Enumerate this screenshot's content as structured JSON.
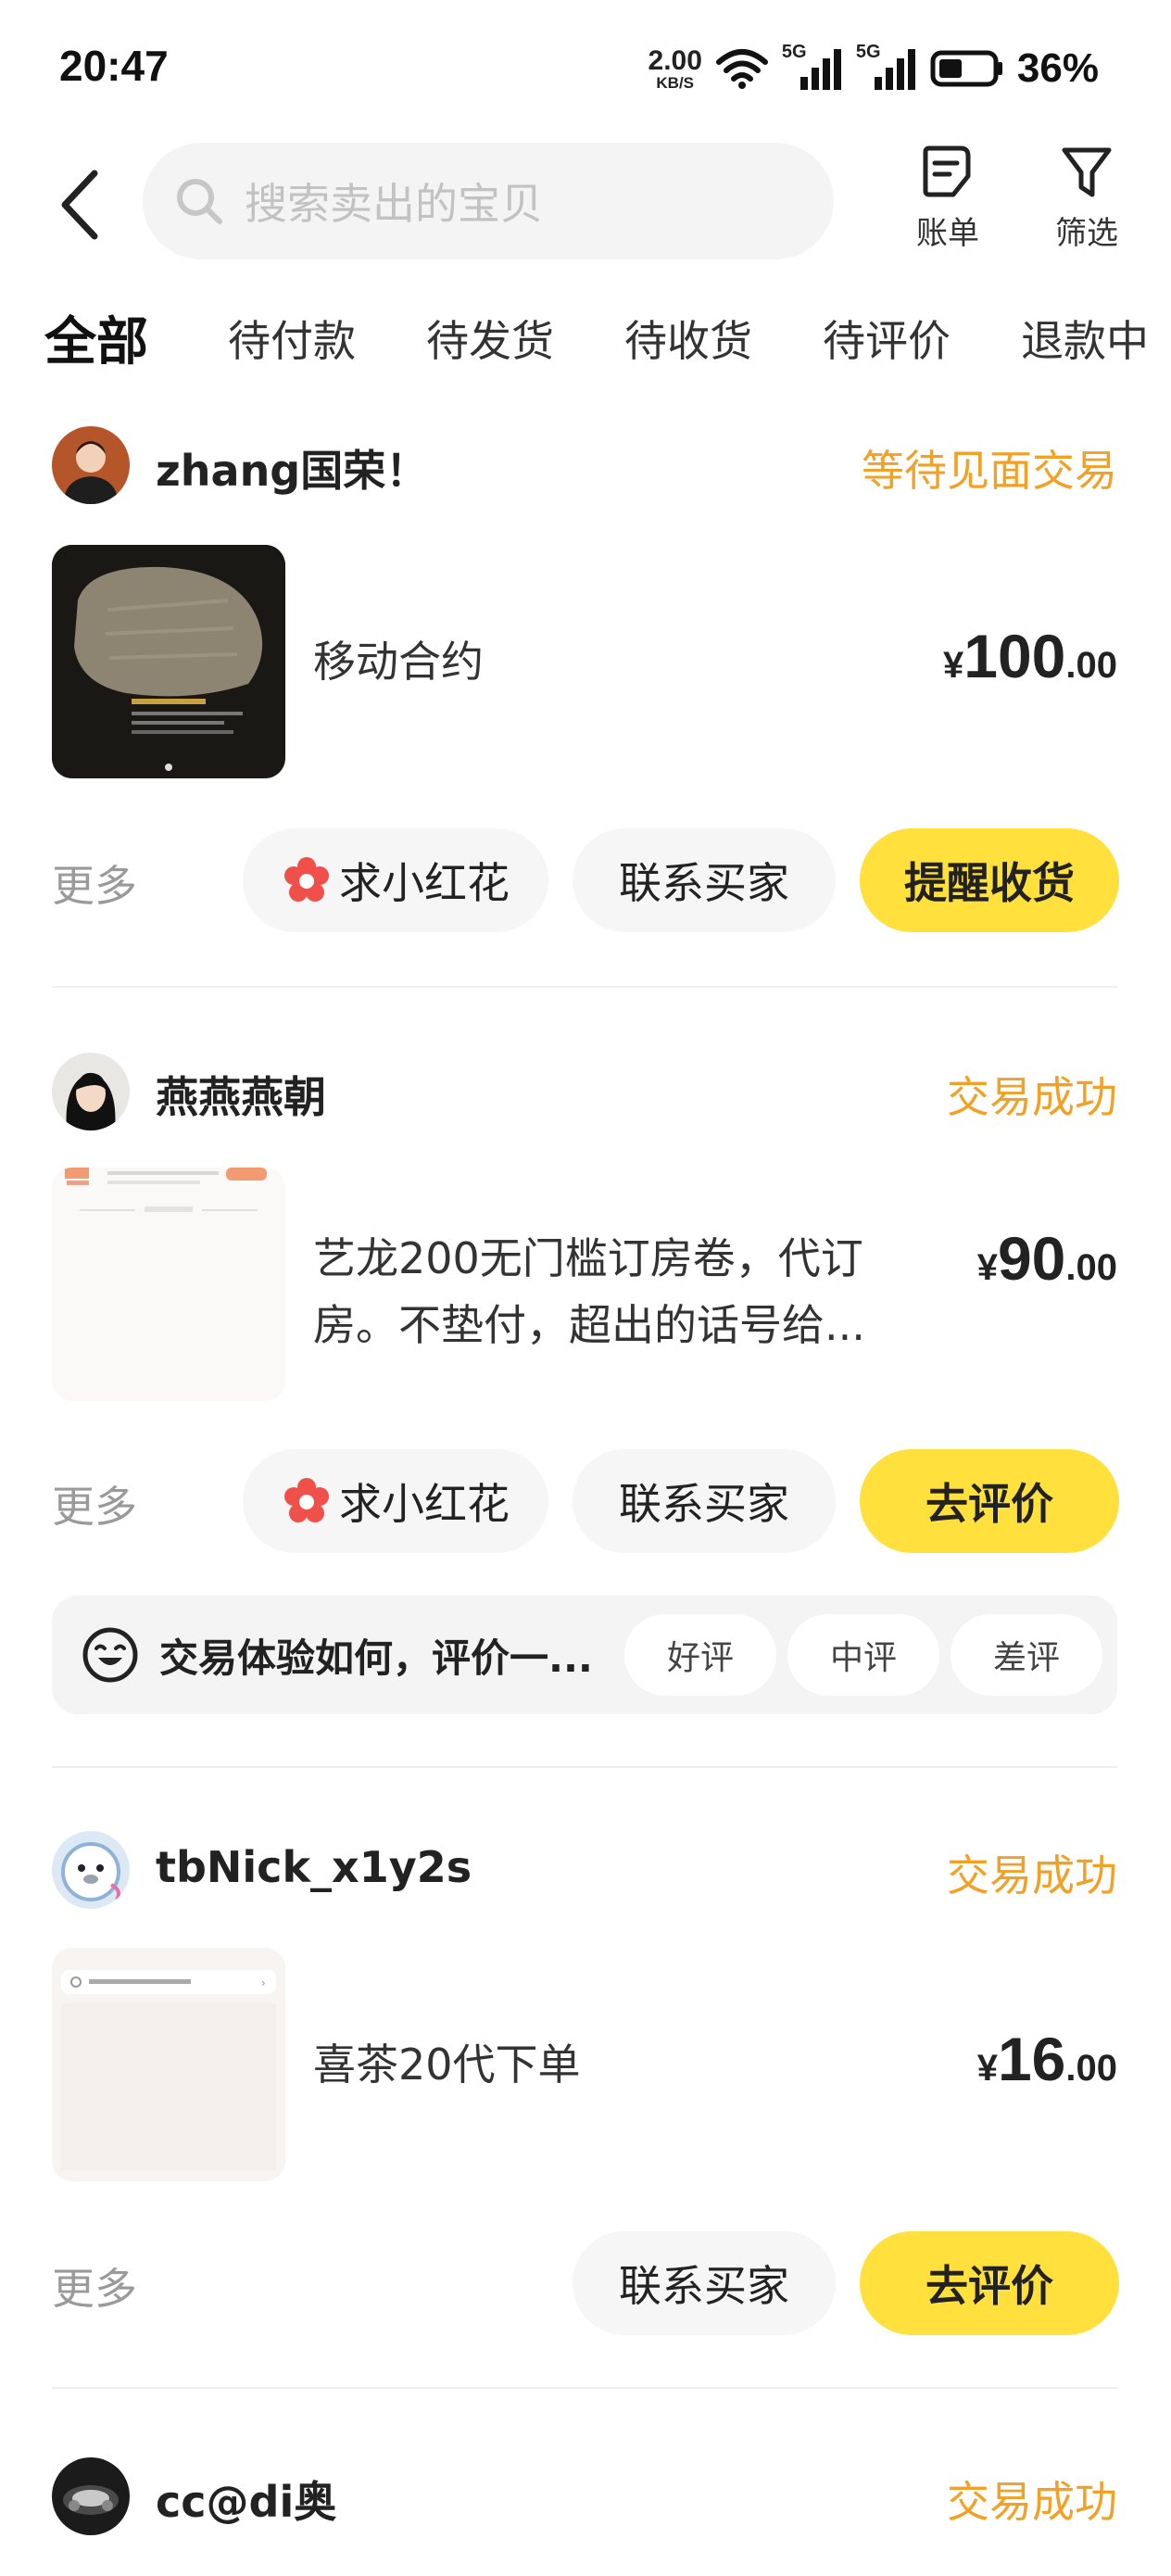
{
  "status_bar": {
    "time": "20:47",
    "net_speed_value": "2.00",
    "net_speed_unit": "KB/S",
    "signal_1": "5G",
    "signal_2": "5G",
    "battery_percent": "36%",
    "icons": [
      "wifi-icon",
      "signal-icon",
      "signal-icon",
      "battery-icon"
    ]
  },
  "header": {
    "search_placeholder": "搜索卖出的宝贝",
    "bill_label": "账单",
    "filter_label": "筛选",
    "icons": [
      "back-arrow-icon",
      "search-icon",
      "bill-icon",
      "filter-icon"
    ]
  },
  "tabs": [
    {
      "label": "全部",
      "active": true
    },
    {
      "label": "待付款"
    },
    {
      "label": "待发货"
    },
    {
      "label": "待收货"
    },
    {
      "label": "待评价"
    },
    {
      "label": "退款中"
    }
  ],
  "orders": [
    {
      "user": "zhang国荣！",
      "status": "等待见面交易",
      "title": "移动合约",
      "price_currency": "¥",
      "price_int": "100",
      "price_dec": ".00",
      "more": "更多",
      "actions": [
        "求小红花",
        "联系买家",
        "提醒收货"
      ]
    },
    {
      "user": "燕燕燕朝",
      "status": "交易成功",
      "title": "艺龙200无门槛订房卷，代订房。不垫付，超出的话号给...",
      "price_currency": "¥",
      "price_int": "90",
      "price_dec": ".00",
      "more": "更多",
      "actions": [
        "求小红花",
        "联系买家",
        "去评价"
      ],
      "review_prompt": "交易体验如何，评价一...",
      "review_options": [
        "好评",
        "中评",
        "差评"
      ]
    },
    {
      "user": "tbNick_x1y2s",
      "status": "交易成功",
      "title": "喜茶20代下单",
      "price_currency": "¥",
      "price_int": "16",
      "price_dec": ".00",
      "more": "更多",
      "actions": [
        "联系买家",
        "去评价"
      ]
    },
    {
      "user": "cc@di奥",
      "status": "交易成功"
    }
  ],
  "colors": {
    "accent_yellow": "#ffe03c",
    "status_orange": "#f0a126",
    "flower_red": "#f0504a"
  }
}
